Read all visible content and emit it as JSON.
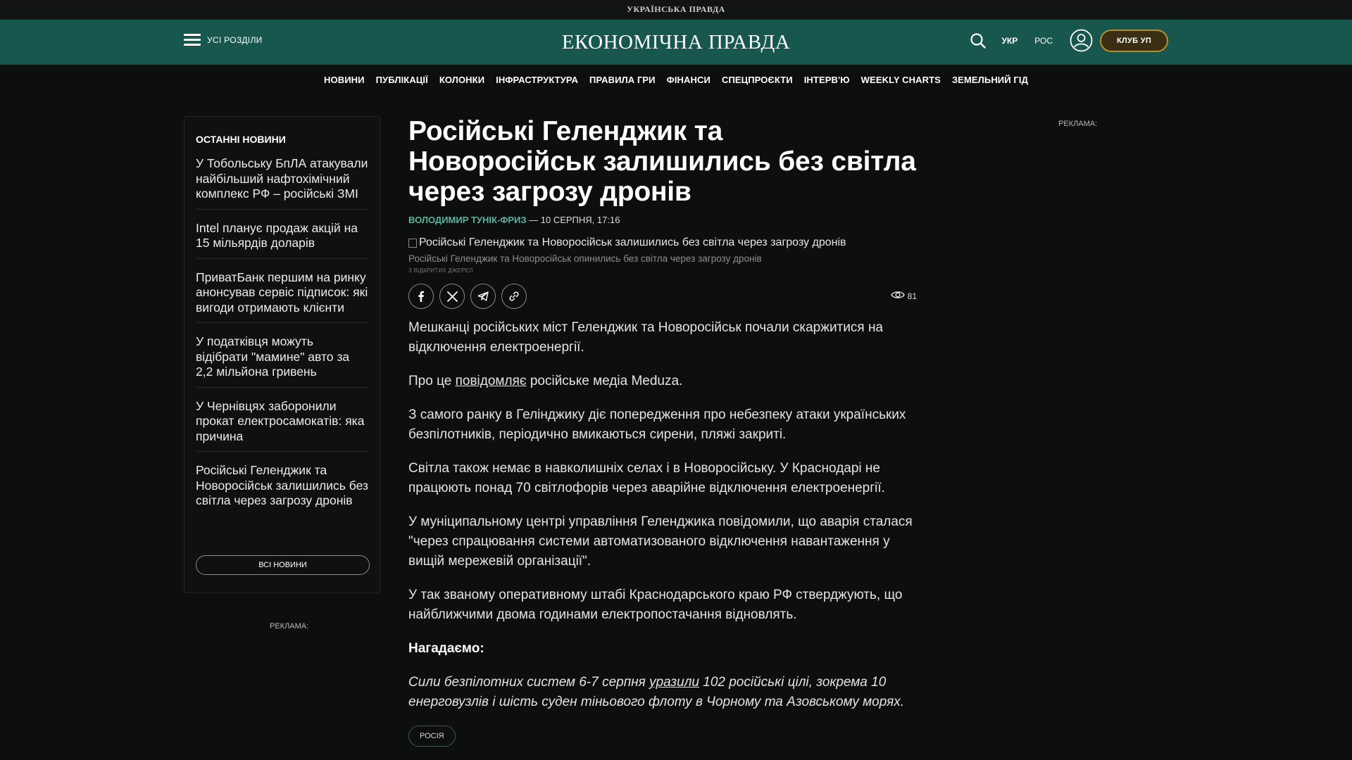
{
  "top_strip": {
    "label": "УКРАЇНСЬКА ПРАВДА"
  },
  "header": {
    "menu_label": "УСІ РОЗДІЛИ",
    "logo": "ЕКОНОМІЧНА ПРАВДА",
    "lang_ukr": "УКР",
    "lang_ros": "РОС",
    "club_label": "КЛУБ УП",
    "accent_color": "#17574e",
    "club_border_color": "#b5902d"
  },
  "nav": {
    "items": [
      "НОВИНИ",
      "ПУБЛІКАЦІЇ",
      "КОЛОНКИ",
      "ІНФРАСТРУКТУРА",
      "ПРАВИЛА ГРИ",
      "ФІНАНСИ",
      "СПЕЦПРОЄКТИ",
      "ІНТЕРВ'Ю",
      "WEEKLY CHARTS",
      "ЗЕМЕЛЬНИЙ ГІД"
    ]
  },
  "sidebar": {
    "title": "ОСТАННІ НОВИНИ",
    "items": [
      "У Тобольську БпЛА атакували найбільший нафтохімічний комплекс РФ – російські ЗМІ",
      "Intel планує продаж акцій на 15 мільярдів доларів",
      "ПриватБанк першим на ринку анонсував сервіс підписок: які вигоди отримають клієнти",
      "У податківця можуть відібрати \"мамине\" авто за 2,2 мільйона гривень",
      "У Чернівцях заборонили прокат електросамокатів: яка причина",
      "Російські Геленджик та Новоросійськ залишились без світла через загрозу дронів"
    ],
    "all_news_label": "ВСІ НОВИНИ"
  },
  "ads": {
    "left_label": "РЕКЛАМА:",
    "right_label": "РЕКЛАМА:"
  },
  "article": {
    "title": "Російські Геленджик та Новоросійськ залишились без світла через загрозу дронів",
    "author": "ВОЛОДИМИР ТУНІК-ФРИЗ",
    "date": " — 10 СЕРПНЯ, 17:16",
    "image_alt": "Російські Геленджик та Новоросійськ залишились без світла через загрозу дронів",
    "caption": "Російські Геленджик та Новоросійськ опинились без світла через загрозу дронів",
    "source": "З ВІДКРИТИХ ДЖЕРЕЛ",
    "share_icons": [
      "facebook-icon",
      "x-icon",
      "telegram-icon",
      "link-icon"
    ],
    "views": "81",
    "p1": "Мешканці російських міст Геленджик та Новоросійськ почали скаржитися на відключення електроенергії.",
    "p2_before": "Про це ",
    "p2_link": "повідомляє",
    "p2_after": " російське медіа Meduza.",
    "p3": "З самого ранку в Гелінджику діє попередження про небезпеку атаки українських безпілотників, періодично вмикаються сирени, пляжі закриті.",
    "p4": "Світла також немає в навколишніх селах і в Новоросійську. У Краснодарі не працюють понад 70 світлофорів через аварійне відключення електроенергії.",
    "p5": "У муніципальному центрі управління Геленджика повідомили, що аварія сталася \"через спрацювання системи автоматизованого відключення навантаження у вищій мережевій організації\".",
    "p6": "У так званому оперативному штабі Краснодарського краю РФ стверджують, що найближчими двома годинами електропостачання відновлять.",
    "remind": "Нагадаємо:",
    "p7_before": "Сили безпілотних систем 6-7 серпня ",
    "p7_link": "уразили",
    "p7_after": " 102 російські цілі, зокрема 10 енерговузлів і шість суден тіньового флоту в Чорному та Азовському морях.",
    "tag": "РОСІЯ"
  }
}
